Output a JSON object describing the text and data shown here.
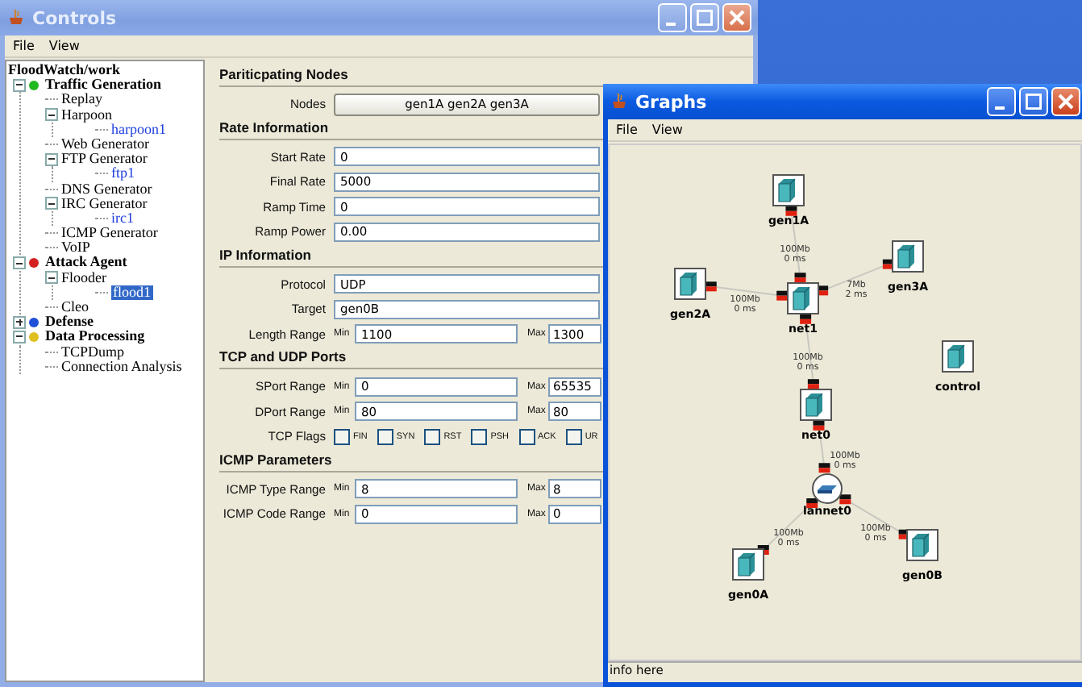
{
  "controls_window": {
    "title": "Controls",
    "menu": [
      "File",
      "View"
    ],
    "tree": {
      "root": "FloodWatch/work",
      "items": [
        {
          "label": "Traffic Generation",
          "kind": "category",
          "color": "#22b822",
          "expanded": true,
          "selected": false,
          "children": [
            {
              "label": "Replay",
              "kind": "group",
              "selected": false
            },
            {
              "label": "Harpoon",
              "kind": "group",
              "expanded": true,
              "selected": false,
              "children": [
                {
                  "label": "harpoon1",
                  "kind": "instance",
                  "selected": false
                }
              ]
            },
            {
              "label": "Web Generator",
              "kind": "group",
              "selected": false
            },
            {
              "label": "FTP Generator",
              "kind": "group",
              "expanded": true,
              "selected": false,
              "children": [
                {
                  "label": "ftp1",
                  "kind": "instance",
                  "selected": false
                }
              ]
            },
            {
              "label": "DNS Generator",
              "kind": "group",
              "selected": false
            },
            {
              "label": "IRC Generator",
              "kind": "group",
              "expanded": true,
              "selected": false,
              "children": [
                {
                  "label": "irc1",
                  "kind": "instance",
                  "selected": false
                }
              ]
            },
            {
              "label": "ICMP Generator",
              "kind": "group",
              "selected": false
            },
            {
              "label": "VoIP",
              "kind": "group",
              "selected": false
            }
          ]
        },
        {
          "label": "Attack Agent",
          "kind": "category",
          "color": "#d42020",
          "expanded": true,
          "selected": false,
          "children": [
            {
              "label": "Flooder",
              "kind": "group",
              "expanded": true,
              "selected": false,
              "children": [
                {
                  "label": "flood1",
                  "kind": "instance",
                  "selected": true
                }
              ]
            },
            {
              "label": "Cleo",
              "kind": "group",
              "selected": false
            }
          ]
        },
        {
          "label": "Defense",
          "kind": "category",
          "color": "#2050d8",
          "expanded": false,
          "selected": false
        },
        {
          "label": "Data Processing",
          "kind": "category",
          "color": "#e0c020",
          "expanded": true,
          "selected": false,
          "children": [
            {
              "label": "TCPDump",
              "kind": "group",
              "selected": false
            },
            {
              "label": "Connection Analysis",
              "kind": "group",
              "selected": false
            }
          ]
        }
      ]
    },
    "sections": [
      {
        "title": "Pariticpating Nodes",
        "rows": [
          {
            "kind": "button",
            "label": "Nodes",
            "value": "gen1A gen2A gen3A"
          }
        ]
      },
      {
        "title": "Rate Information",
        "rows": [
          {
            "kind": "text",
            "label": "Start Rate",
            "value": "0"
          },
          {
            "kind": "text",
            "label": "Final Rate",
            "value": "5000"
          },
          {
            "kind": "text",
            "label": "Ramp Time",
            "value": "0"
          },
          {
            "kind": "text",
            "label": "Ramp Power",
            "value": "0.00"
          }
        ]
      },
      {
        "title": "IP Information",
        "rows": [
          {
            "kind": "text",
            "label": "Protocol",
            "value": "UDP"
          },
          {
            "kind": "text",
            "label": "Target",
            "value": "gen0B"
          },
          {
            "kind": "range",
            "label": "Length Range",
            "min_label": "Min",
            "min": "1100",
            "max_label": "Max",
            "max": "1300"
          }
        ]
      },
      {
        "title": "TCP and UDP Ports",
        "rows": [
          {
            "kind": "range",
            "label": "SPort Range",
            "min_label": "Min",
            "min": "0",
            "max_label": "Max",
            "max": "65535"
          },
          {
            "kind": "range",
            "label": "DPort Range",
            "min_label": "Min",
            "min": "80",
            "max_label": "Max",
            "max": "80"
          },
          {
            "kind": "flags",
            "label": "TCP Flags",
            "flags": [
              {
                "label": "FIN",
                "checked": false
              },
              {
                "label": "SYN",
                "checked": false
              },
              {
                "label": "RST",
                "checked": false
              },
              {
                "label": "PSH",
                "checked": false
              },
              {
                "label": "ACK",
                "checked": false
              },
              {
                "label": "UR",
                "checked": false
              }
            ]
          }
        ]
      },
      {
        "title": "ICMP Parameters",
        "rows": [
          {
            "kind": "range",
            "label": "ICMP Type Range",
            "min_label": "Min",
            "min": "8",
            "max_label": "Max",
            "max": "8"
          },
          {
            "kind": "range",
            "label": "ICMP Code Range",
            "min_label": "Min",
            "min": "0",
            "max_label": "Max",
            "max": "0"
          }
        ]
      }
    ]
  },
  "graphs_window": {
    "title": "Graphs",
    "menu": [
      "File",
      "View"
    ],
    "nodes": [
      {
        "label": "gen1A",
        "kind": "host"
      },
      {
        "label": "gen2A",
        "kind": "host"
      },
      {
        "label": "gen3A",
        "kind": "host"
      },
      {
        "label": "net1",
        "kind": "host"
      },
      {
        "label": "control",
        "kind": "host"
      },
      {
        "label": "net0",
        "kind": "host"
      },
      {
        "label": "lannet0",
        "kind": "switch"
      },
      {
        "label": "gen0A",
        "kind": "host"
      },
      {
        "label": "gen0B",
        "kind": "host"
      }
    ],
    "links": [
      {
        "bandwidth": "100Mb",
        "delay": "0 ms"
      },
      {
        "bandwidth": "100Mb",
        "delay": "0 ms"
      },
      {
        "bandwidth": "7Mb",
        "delay": "2 ms"
      },
      {
        "bandwidth": "100Mb",
        "delay": "0 ms"
      },
      {
        "bandwidth": "100Mb",
        "delay": "0 ms"
      },
      {
        "bandwidth": "100Mb",
        "delay": "0 ms"
      },
      {
        "bandwidth": "100Mb",
        "delay": "0 ms"
      }
    ],
    "status": "info here"
  }
}
